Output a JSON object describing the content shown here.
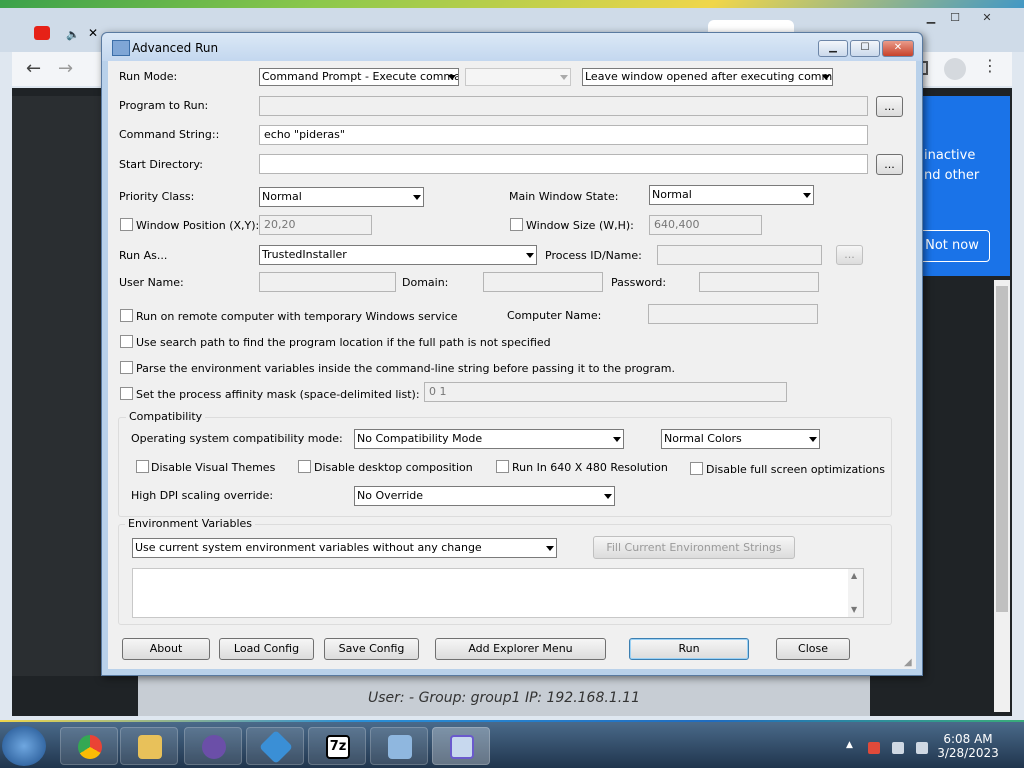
{
  "browser": {
    "popup_line1": "inactive",
    "popup_line2": "nd other",
    "popup_button": "Not now",
    "status": "User: -    Group: group1   IP: 192.168.1.11"
  },
  "dialog": {
    "title": "Advanced Run",
    "title_buttons": {
      "minimize": "▁",
      "maximize": "☐",
      "close": "✕"
    },
    "run_mode": {
      "label": "Run Mode:",
      "value": "Command Prompt - Execute command",
      "second": "",
      "third": "Leave window opened after executing command"
    },
    "program_to_run": {
      "label": "Program to Run:",
      "value": "",
      "browse": "..."
    },
    "command_string": {
      "label": "Command String::",
      "value": "echo \"pideras\""
    },
    "start_directory": {
      "label": "Start Directory:",
      "value": "",
      "browse": "..."
    },
    "priority_class": {
      "label": "Priority Class:",
      "value": "Normal"
    },
    "main_window_state": {
      "label": "Main Window State:",
      "value": "Normal"
    },
    "window_position": {
      "label": "Window Position (X,Y):",
      "value": "20,20"
    },
    "window_size": {
      "label": "Window Size (W,H):",
      "value": "640,400"
    },
    "run_as": {
      "label": "Run As...",
      "value": "TrustedInstaller"
    },
    "process_id": {
      "label": "Process ID/Name:",
      "value": "",
      "browse": "..."
    },
    "user_name": {
      "label": "User Name:",
      "value": ""
    },
    "domain": {
      "label": "Domain:",
      "value": ""
    },
    "password": {
      "label": "Password:",
      "value": ""
    },
    "remote": {
      "label": "Run on remote computer with temporary Windows service"
    },
    "computer_name": {
      "label": "Computer Name:",
      "value": ""
    },
    "search_path": {
      "label": "Use search path to find the program location if the full path is not specified"
    },
    "parse_env": {
      "label": "Parse the environment variables inside the command-line string before passing it to the program."
    },
    "affinity": {
      "label": "Set the process affinity mask (space-delimited list):",
      "value": "0 1"
    },
    "compatibility": {
      "title": "Compatibility",
      "os_mode_label": "Operating system compatibility mode:",
      "os_mode_value": "No Compatibility Mode",
      "colors_value": "Normal Colors",
      "disable_visual_themes": "Disable Visual Themes",
      "disable_desktop_composition": "Disable desktop composition",
      "run_640": "Run In 640 X 480 Resolution",
      "disable_fullscreen": "Disable full screen optimizations",
      "dpi_label": "High DPI scaling override:",
      "dpi_value": "No Override"
    },
    "environment": {
      "title": "Environment Variables",
      "mode_value": "Use current system environment variables without any change",
      "fill_button": "Fill Current Environment Strings",
      "text": ""
    },
    "buttons": {
      "about": "About",
      "load_config": "Load Config",
      "save_config": "Save Config",
      "add_explorer_menu": "Add Explorer Menu",
      "run": "Run",
      "close": "Close"
    }
  },
  "taskbar": {
    "time": "6:08 AM",
    "date": "3/28/2023",
    "sevenzip": "7z"
  }
}
